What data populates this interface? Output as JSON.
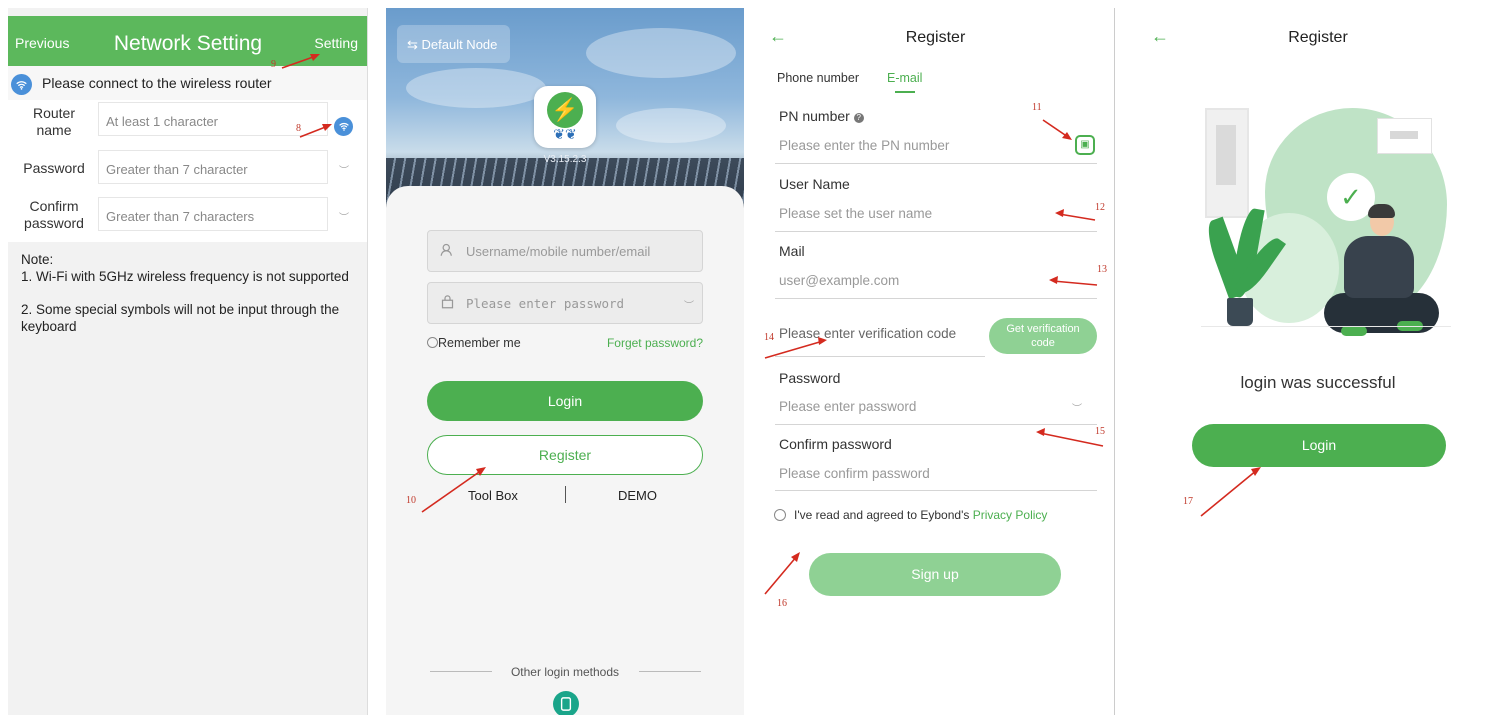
{
  "network_setting": {
    "prev_label": "Previous",
    "title": "Network Setting",
    "setting_label": "Setting",
    "connect_msg": "Please connect to the wireless router",
    "router_label_1": "Router",
    "router_label_2": "name",
    "router_placeholder": "At least 1 character",
    "password_label": "Password",
    "password_placeholder": "Greater than 7 character",
    "confirm_label_1": "Confirm",
    "confirm_label_2": "password",
    "confirm_placeholder": "Greater than 7 characters",
    "note_title": "Note:",
    "note_1": "1. Wi-Fi with 5GHz wireless frequency is not supported",
    "note_2": "2. Some special symbols will not be input through the keyboard"
  },
  "login_screen": {
    "node_label": "⇆ Default Node",
    "version": "V3.15.2.3",
    "username_placeholder": "Username/mobile number/email",
    "password_placeholder": "Please enter password",
    "remember_label": "Remember me",
    "forgot_label": "Forget password?",
    "login_label": "Login",
    "register_label": "Register",
    "toolbox_label": "Tool Box",
    "demo_label": "DEMO",
    "other_methods": "Other login methods"
  },
  "register_form": {
    "back_icon": "←",
    "title": "Register",
    "tab_phone": "Phone number",
    "tab_email": "E-mail",
    "pn_label": "PN number",
    "pn_placeholder": "Please enter the PN number",
    "username_label": "User Name",
    "username_placeholder": "Please set the user name",
    "mail_label": "Mail",
    "mail_placeholder": "user@example.com",
    "verify_placeholder": "Please enter verification code",
    "verify_btn_1": "Get verification",
    "verify_btn_2": "code",
    "password_label": "Password",
    "password_placeholder": "Please enter password",
    "confirm_label": "Confirm password",
    "confirm_placeholder": "Please confirm password",
    "agree_text": "I've read and agreed to Eybond's ",
    "privacy_link": "Privacy Policy",
    "signup_label": "Sign up"
  },
  "register_success": {
    "back_icon": "←",
    "title": "Register",
    "success_msg": "login was successful",
    "login_label": "Login"
  },
  "annotations": {
    "n8": "8",
    "n9": "9",
    "n10": "10",
    "n11": "11",
    "n12": "12",
    "n13": "13",
    "n14": "14",
    "n15": "15",
    "n16": "16",
    "n17": "17"
  },
  "colors": {
    "brand_green": "#4caf50",
    "header_green": "#5cb85c",
    "disabled_green": "#8fd194",
    "wifi_blue": "#4a90d9",
    "annotation_red": "#c0392b"
  },
  "icons": {
    "wifi": "wifi-icon",
    "eye": "eye-icon",
    "user": "user-icon",
    "lock": "lock-icon",
    "scan": "scan-icon",
    "info": "info-icon",
    "phone": "phone-icon",
    "check": "check-icon",
    "back": "back-arrow-icon"
  }
}
